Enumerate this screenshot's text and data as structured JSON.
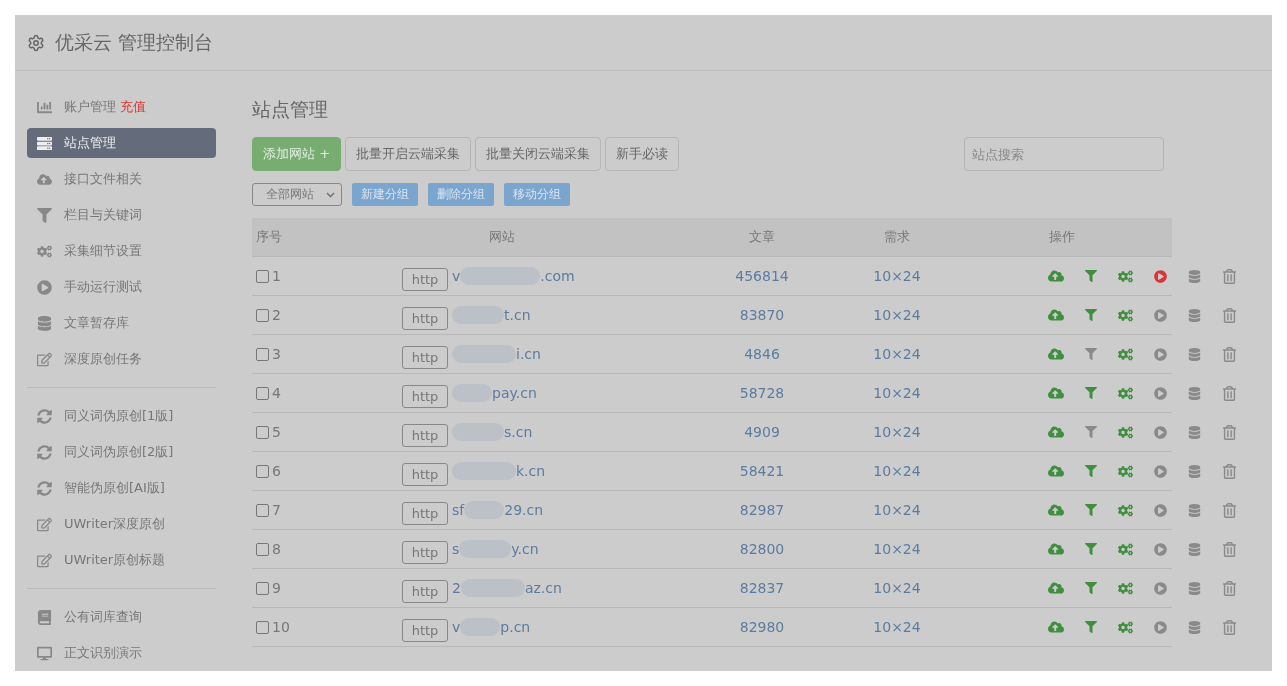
{
  "header": {
    "title": "优采云 管理控制台"
  },
  "sidebar": {
    "groups": [
      {
        "items": [
          {
            "label": "账户管理",
            "badge": "充值",
            "selected": false
          },
          {
            "label": "站点管理",
            "selected": true
          },
          {
            "label": "接口文件相关",
            "selected": false
          },
          {
            "label": "栏目与关键词",
            "selected": false
          },
          {
            "label": "采集细节设置",
            "selected": false
          },
          {
            "label": "手动运行测试",
            "selected": false
          },
          {
            "label": "文章暂存库",
            "selected": false
          },
          {
            "label": "深度原创任务",
            "selected": false
          }
        ]
      },
      {
        "items": [
          {
            "label": "同义词伪原创[1版]",
            "selected": false
          },
          {
            "label": "同义词伪原创[2版]",
            "selected": false
          },
          {
            "label": "智能伪原创[AI版]",
            "selected": false
          },
          {
            "label": "UWriter深度原创",
            "selected": false
          },
          {
            "label": "UWriter原创标题",
            "selected": false
          }
        ]
      },
      {
        "items": [
          {
            "label": "公有词库查询",
            "selected": false
          },
          {
            "label": "正文识别演示",
            "selected": false
          }
        ]
      }
    ]
  },
  "main": {
    "title": "站点管理",
    "add_button": "添加网站 +",
    "buttons": [
      "批量开启云端采集",
      "批量关闭云端采集",
      "新手必读"
    ],
    "search": {
      "placeholder": "站点搜索"
    },
    "group_select": "全部网站",
    "group_buttons": [
      "新建分组",
      "删除分组",
      "移动分组"
    ],
    "table": {
      "columns": [
        "序号",
        "网站",
        "文章",
        "需求",
        "操作"
      ],
      "rows": [
        {
          "checked": false,
          "index": "1",
          "scheme": "http",
          "site_start": "v",
          "site_end": ".com",
          "articles": "456814",
          "demand": "10×24",
          "filter_on": true,
          "running": true
        },
        {
          "checked": false,
          "index": "2",
          "scheme": "http",
          "site_start": "",
          "site_end": "t.cn",
          "articles": "83870",
          "demand": "10×24",
          "filter_on": true,
          "running": false
        },
        {
          "checked": false,
          "index": "3",
          "scheme": "http",
          "site_start": "",
          "site_end": "i.cn",
          "articles": "4846",
          "demand": "10×24",
          "filter_on": false,
          "running": false
        },
        {
          "checked": false,
          "index": "4",
          "scheme": "http",
          "site_start": "",
          "site_end": "pay.cn",
          "articles": "58728",
          "demand": "10×24",
          "filter_on": true,
          "running": false
        },
        {
          "checked": false,
          "index": "5",
          "scheme": "http",
          "site_start": "",
          "site_end": "s.cn",
          "articles": "4909",
          "demand": "10×24",
          "filter_on": false,
          "running": false
        },
        {
          "checked": false,
          "index": "6",
          "scheme": "http",
          "site_start": "",
          "site_end": "k.cn",
          "articles": "58421",
          "demand": "10×24",
          "filter_on": true,
          "running": false
        },
        {
          "checked": false,
          "index": "7",
          "scheme": "http",
          "site_start": "sf",
          "site_end": "29.cn",
          "articles": "82987",
          "demand": "10×24",
          "filter_on": true,
          "running": false
        },
        {
          "checked": false,
          "index": "8",
          "scheme": "http",
          "site_start": "s",
          "site_end": "y.cn",
          "articles": "82800",
          "demand": "10×24",
          "filter_on": true,
          "running": false
        },
        {
          "checked": false,
          "index": "9",
          "scheme": "http",
          "site_start": "2",
          "site_end": "az.cn",
          "articles": "82837",
          "demand": "10×24",
          "filter_on": true,
          "running": false
        },
        {
          "checked": false,
          "index": "10",
          "scheme": "http",
          "site_start": "v",
          "site_end": "p.cn",
          "articles": "82980",
          "demand": "10×24",
          "filter_on": true,
          "running": false
        }
      ]
    }
  }
}
